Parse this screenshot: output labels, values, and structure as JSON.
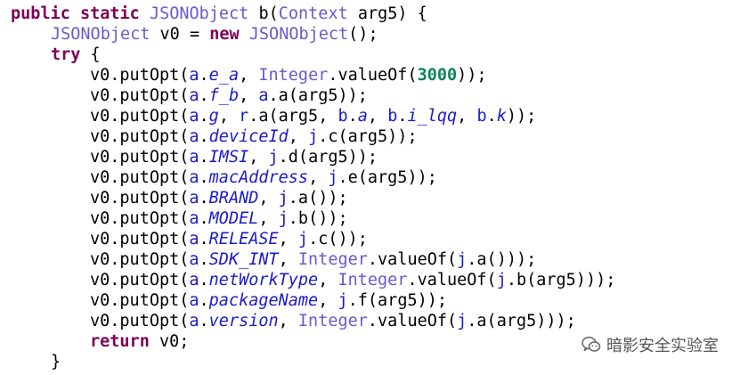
{
  "code": {
    "lines": [
      {
        "indent": 0,
        "tokens": [
          {
            "t": "public",
            "c": "kw"
          },
          {
            "t": " ",
            "c": "plain"
          },
          {
            "t": "static",
            "c": "kw"
          },
          {
            "t": " ",
            "c": "plain"
          },
          {
            "t": "JSONObject",
            "c": "type"
          },
          {
            "t": " b(",
            "c": "plain"
          },
          {
            "t": "Context",
            "c": "type"
          },
          {
            "t": " arg5) {",
            "c": "plain"
          }
        ]
      },
      {
        "indent": 1,
        "tokens": [
          {
            "t": "JSONObject",
            "c": "type"
          },
          {
            "t": " v0 = ",
            "c": "plain"
          },
          {
            "t": "new",
            "c": "kw"
          },
          {
            "t": " ",
            "c": "plain"
          },
          {
            "t": "JSONObject",
            "c": "type"
          },
          {
            "t": "();",
            "c": "plain"
          }
        ]
      },
      {
        "indent": 1,
        "tokens": [
          {
            "t": "try",
            "c": "kw"
          },
          {
            "t": " {",
            "c": "plain"
          }
        ]
      },
      {
        "indent": 2,
        "tokens": [
          {
            "t": "v0.putOpt(",
            "c": "plain"
          },
          {
            "t": "a",
            "c": "cls"
          },
          {
            "t": ".",
            "c": "plain"
          },
          {
            "t": "e_a",
            "c": "field"
          },
          {
            "t": ", ",
            "c": "plain"
          },
          {
            "t": "Integer",
            "c": "type"
          },
          {
            "t": ".valueOf(",
            "c": "plain"
          },
          {
            "t": "3000",
            "c": "num"
          },
          {
            "t": "));",
            "c": "plain"
          }
        ]
      },
      {
        "indent": 2,
        "tokens": [
          {
            "t": "v0.putOpt(",
            "c": "plain"
          },
          {
            "t": "a",
            "c": "cls"
          },
          {
            "t": ".",
            "c": "plain"
          },
          {
            "t": "f_b",
            "c": "field"
          },
          {
            "t": ", ",
            "c": "plain"
          },
          {
            "t": "a",
            "c": "cls"
          },
          {
            "t": ".a(arg5));",
            "c": "plain"
          }
        ]
      },
      {
        "indent": 2,
        "tokens": [
          {
            "t": "v0.putOpt(",
            "c": "plain"
          },
          {
            "t": "a",
            "c": "cls"
          },
          {
            "t": ".",
            "c": "plain"
          },
          {
            "t": "g",
            "c": "field"
          },
          {
            "t": ", ",
            "c": "plain"
          },
          {
            "t": "r",
            "c": "cls"
          },
          {
            "t": ".a(arg5, ",
            "c": "plain"
          },
          {
            "t": "b",
            "c": "cls"
          },
          {
            "t": ".",
            "c": "plain"
          },
          {
            "t": "a",
            "c": "field"
          },
          {
            "t": ", ",
            "c": "plain"
          },
          {
            "t": "b",
            "c": "cls"
          },
          {
            "t": ".",
            "c": "plain"
          },
          {
            "t": "i_lqq",
            "c": "field"
          },
          {
            "t": ", ",
            "c": "plain"
          },
          {
            "t": "b",
            "c": "cls"
          },
          {
            "t": ".",
            "c": "plain"
          },
          {
            "t": "k",
            "c": "field"
          },
          {
            "t": "));",
            "c": "plain"
          }
        ]
      },
      {
        "indent": 2,
        "tokens": [
          {
            "t": "v0.putOpt(",
            "c": "plain"
          },
          {
            "t": "a",
            "c": "cls"
          },
          {
            "t": ".",
            "c": "plain"
          },
          {
            "t": "deviceId",
            "c": "field"
          },
          {
            "t": ", ",
            "c": "plain"
          },
          {
            "t": "j",
            "c": "cls"
          },
          {
            "t": ".c(arg5));",
            "c": "plain"
          }
        ]
      },
      {
        "indent": 2,
        "tokens": [
          {
            "t": "v0.putOpt(",
            "c": "plain"
          },
          {
            "t": "a",
            "c": "cls"
          },
          {
            "t": ".",
            "c": "plain"
          },
          {
            "t": "IMSI",
            "c": "field"
          },
          {
            "t": ", ",
            "c": "plain"
          },
          {
            "t": "j",
            "c": "cls"
          },
          {
            "t": ".d(arg5));",
            "c": "plain"
          }
        ]
      },
      {
        "indent": 2,
        "tokens": [
          {
            "t": "v0.putOpt(",
            "c": "plain"
          },
          {
            "t": "a",
            "c": "cls"
          },
          {
            "t": ".",
            "c": "plain"
          },
          {
            "t": "macAddress",
            "c": "field"
          },
          {
            "t": ", ",
            "c": "plain"
          },
          {
            "t": "j",
            "c": "cls"
          },
          {
            "t": ".e(arg5));",
            "c": "plain"
          }
        ]
      },
      {
        "indent": 2,
        "tokens": [
          {
            "t": "v0.putOpt(",
            "c": "plain"
          },
          {
            "t": "a",
            "c": "cls"
          },
          {
            "t": ".",
            "c": "plain"
          },
          {
            "t": "BRAND",
            "c": "field"
          },
          {
            "t": ", ",
            "c": "plain"
          },
          {
            "t": "j",
            "c": "cls"
          },
          {
            "t": ".a());",
            "c": "plain"
          }
        ]
      },
      {
        "indent": 2,
        "tokens": [
          {
            "t": "v0.putOpt(",
            "c": "plain"
          },
          {
            "t": "a",
            "c": "cls"
          },
          {
            "t": ".",
            "c": "plain"
          },
          {
            "t": "MODEL",
            "c": "field"
          },
          {
            "t": ", ",
            "c": "plain"
          },
          {
            "t": "j",
            "c": "cls"
          },
          {
            "t": ".b());",
            "c": "plain"
          }
        ]
      },
      {
        "indent": 2,
        "tokens": [
          {
            "t": "v0.putOpt(",
            "c": "plain"
          },
          {
            "t": "a",
            "c": "cls"
          },
          {
            "t": ".",
            "c": "plain"
          },
          {
            "t": "RELEASE",
            "c": "field"
          },
          {
            "t": ", ",
            "c": "plain"
          },
          {
            "t": "j",
            "c": "cls"
          },
          {
            "t": ".c());",
            "c": "plain"
          }
        ]
      },
      {
        "indent": 2,
        "tokens": [
          {
            "t": "v0.putOpt(",
            "c": "plain"
          },
          {
            "t": "a",
            "c": "cls"
          },
          {
            "t": ".",
            "c": "plain"
          },
          {
            "t": "SDK_INT",
            "c": "field"
          },
          {
            "t": ", ",
            "c": "plain"
          },
          {
            "t": "Integer",
            "c": "type"
          },
          {
            "t": ".valueOf(",
            "c": "plain"
          },
          {
            "t": "j",
            "c": "cls"
          },
          {
            "t": ".a()));",
            "c": "plain"
          }
        ]
      },
      {
        "indent": 2,
        "tokens": [
          {
            "t": "v0.putOpt(",
            "c": "plain"
          },
          {
            "t": "a",
            "c": "cls"
          },
          {
            "t": ".",
            "c": "plain"
          },
          {
            "t": "netWorkType",
            "c": "field"
          },
          {
            "t": ", ",
            "c": "plain"
          },
          {
            "t": "Integer",
            "c": "type"
          },
          {
            "t": ".valueOf(",
            "c": "plain"
          },
          {
            "t": "j",
            "c": "cls"
          },
          {
            "t": ".b(arg5)));",
            "c": "plain"
          }
        ]
      },
      {
        "indent": 2,
        "tokens": [
          {
            "t": "v0.putOpt(",
            "c": "plain"
          },
          {
            "t": "a",
            "c": "cls"
          },
          {
            "t": ".",
            "c": "plain"
          },
          {
            "t": "packageName",
            "c": "field"
          },
          {
            "t": ", ",
            "c": "plain"
          },
          {
            "t": "j",
            "c": "cls"
          },
          {
            "t": ".f(arg5));",
            "c": "plain"
          }
        ]
      },
      {
        "indent": 2,
        "tokens": [
          {
            "t": "v0.putOpt(",
            "c": "plain"
          },
          {
            "t": "a",
            "c": "cls"
          },
          {
            "t": ".",
            "c": "plain"
          },
          {
            "t": "version",
            "c": "field"
          },
          {
            "t": ", ",
            "c": "plain"
          },
          {
            "t": "Integer",
            "c": "type"
          },
          {
            "t": ".valueOf(",
            "c": "plain"
          },
          {
            "t": "j",
            "c": "cls"
          },
          {
            "t": ".a(arg5)));",
            "c": "plain"
          }
        ]
      },
      {
        "indent": 2,
        "tokens": [
          {
            "t": "return",
            "c": "kw"
          },
          {
            "t": " v0;",
            "c": "plain"
          }
        ]
      },
      {
        "indent": 1,
        "tokens": [
          {
            "t": "}",
            "c": "plain"
          }
        ]
      }
    ]
  },
  "watermark": {
    "icon": "wechat-icon",
    "text": "暗影安全实验室"
  },
  "colors": {
    "keyword": "#7f0055",
    "type": "#6a5acd",
    "field": "#1a1acc",
    "number": "#098658"
  }
}
